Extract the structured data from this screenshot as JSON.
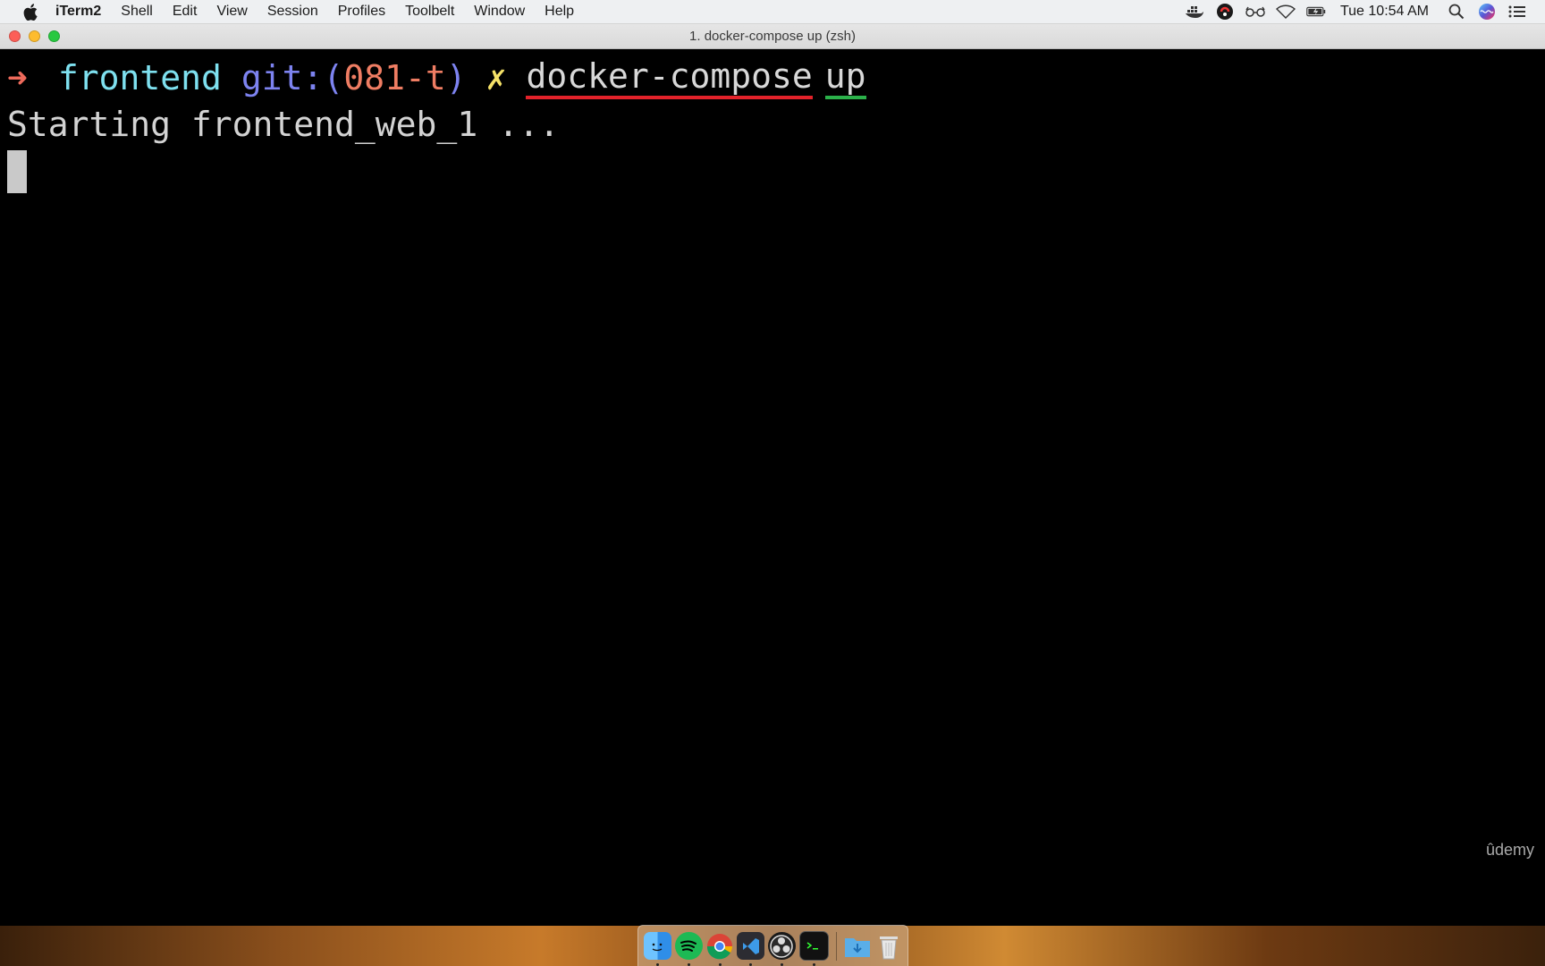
{
  "menubar": {
    "app_name": "iTerm2",
    "items": [
      "Shell",
      "Edit",
      "View",
      "Session",
      "Profiles",
      "Toolbelt",
      "Window",
      "Help"
    ],
    "clock": "Tue 10:54 AM",
    "status_icons": [
      "docker-icon",
      "creative-cloud-icon",
      "glasses-icon",
      "wifi-icon",
      "battery-icon",
      "search-icon",
      "siri-icon",
      "notification-center-icon"
    ]
  },
  "window": {
    "title": "1. docker-compose up (zsh)"
  },
  "terminal": {
    "prompt_arrow": "➜",
    "directory": "frontend",
    "git_label_open": "git:(",
    "branch": "081-t",
    "git_label_close": ")",
    "dirty_marker": "✗",
    "command": "docker-compose",
    "command_arg": "up",
    "output_line": "Starting frontend_web_1 ...",
    "colors": {
      "arrow": "#ee6a5b",
      "directory": "#7ee0ef",
      "git": "#7d83f0",
      "branch": "#ef7d63",
      "dirty": "#f5e268",
      "underline_command": "#e3222a",
      "underline_arg": "#2bb14a"
    }
  },
  "watermark": "ûdemy",
  "dock": {
    "apps": [
      "finder-icon",
      "spotify-icon",
      "chrome-icon",
      "vscode-icon",
      "obs-icon",
      "terminal-icon",
      "downloads-folder-icon",
      "trash-icon"
    ]
  }
}
